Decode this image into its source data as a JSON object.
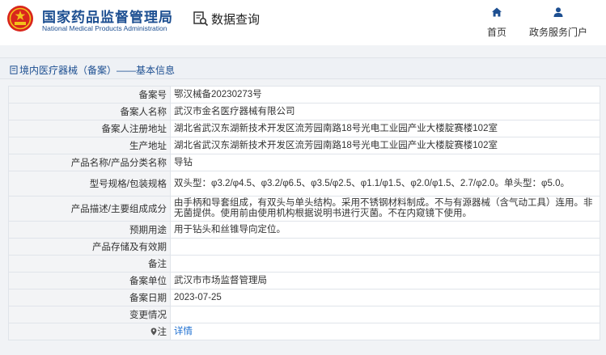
{
  "header": {
    "org_name": "国家药品监督管理局",
    "org_name_en": "National Medical Products Administration",
    "query_label": "数据查询",
    "nav": [
      {
        "label": "首页",
        "icon": "home-icon"
      },
      {
        "label": "政务服务门户",
        "icon": "user-icon"
      }
    ]
  },
  "breadcrumb": {
    "text": "境内医疗器械（备案）——基本信息"
  },
  "record": {
    "rows": [
      {
        "label": "备案号",
        "value": "鄂汉械备20230273号"
      },
      {
        "label": "备案人名称",
        "value": "武汉市金名医疗器械有限公司"
      },
      {
        "label": "备案人注册地址",
        "value": "湖北省武汉东湖新技术开发区流芳园南路18号光电工业园产业大楼腚赛楼102室"
      },
      {
        "label": "生产地址",
        "value": "湖北省武汉东湖新技术开发区流芳园南路18号光电工业园产业大楼腚赛楼102室"
      },
      {
        "label": "产品名称/产品分类名称",
        "value": "导钻"
      },
      {
        "label": "型号规格/包装规格",
        "value": "双头型：φ3.2/φ4.5、φ3.2/φ6.5、φ3.5/φ2.5、φ1.1/φ1.5、φ2.0/φ1.5、2.7/φ2.0。单头型：φ5.0。"
      },
      {
        "label": "产品描述/主要组成成分",
        "value": "由手柄和导套组成，有双头与单头结构。采用不锈钢材料制成。不与有源器械（含气动工具）连用。非无菌提供。使用前由使用机构根据说明书进行灭菌。不在内窥镜下使用。"
      },
      {
        "label": "预期用途",
        "value": "用于钻头和丝锥导向定位。"
      },
      {
        "label": "产品存储及有效期",
        "value": ""
      },
      {
        "label": "备注",
        "value": ""
      },
      {
        "label": "备案单位",
        "value": "武汉市市场监督管理局"
      },
      {
        "label": "备案日期",
        "value": "2023-07-25"
      },
      {
        "label": "变更情况",
        "value": ""
      },
      {
        "label": "注",
        "value": "详情"
      }
    ]
  }
}
